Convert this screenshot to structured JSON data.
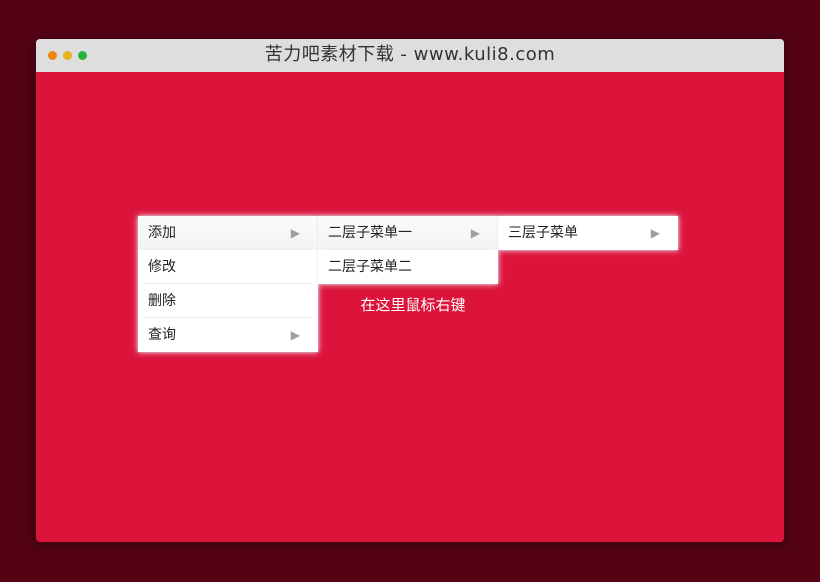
{
  "window": {
    "title": "苦力吧素材下载 - www.kuli8.com",
    "controls": [
      "orange-dot",
      "yellow-dot",
      "green-dot"
    ],
    "colors": {
      "page_background": "#540315",
      "content_background": "#dc143c",
      "titlebar": "#dedede",
      "dot_orange": "#f0820f",
      "dot_yellow": "#e6b420",
      "dot_green": "#28b43c"
    }
  },
  "hint_text": "在这里鼠标右键",
  "context_menu": {
    "level1": [
      {
        "label": "添加",
        "has_submenu": true,
        "arrow": "▶"
      },
      {
        "label": "修改",
        "has_submenu": false
      },
      {
        "label": "删除",
        "has_submenu": false
      },
      {
        "label": "查询",
        "has_submenu": true,
        "arrow": "▶"
      }
    ],
    "level2": [
      {
        "label": "二层子菜单一",
        "has_submenu": true,
        "arrow": "▶"
      },
      {
        "label": "二层子菜单二",
        "has_submenu": false
      }
    ],
    "level3": [
      {
        "label": "三层子菜单",
        "has_submenu": true,
        "arrow": "▶"
      }
    ]
  }
}
